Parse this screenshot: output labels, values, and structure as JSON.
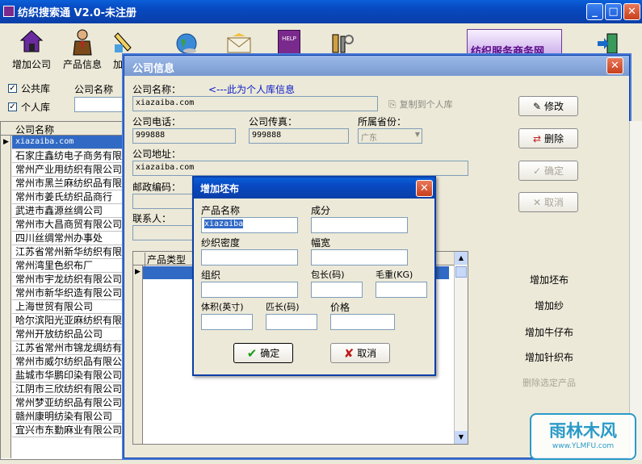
{
  "main": {
    "title": "纺织搜索通 V2.0-未注册",
    "toolbar": [
      {
        "label": "增加公司",
        "icon": "house-icon"
      },
      {
        "label": "产品信息",
        "icon": "businessman-icon"
      },
      {
        "label": "加",
        "icon": "pen-icon"
      },
      {
        "label": "",
        "icon": "globe-icon"
      },
      {
        "label": "",
        "icon": "mail-icon"
      },
      {
        "label": "",
        "icon": "help-book-icon"
      },
      {
        "label": "",
        "icon": "tools-icon"
      },
      {
        "label": "",
        "icon": "exit-icon"
      }
    ],
    "banner_text": "纺织服务商务网",
    "filter": {
      "public_label": "公共库",
      "private_label": "个人库",
      "company_name_label": "公司名称"
    },
    "grid": {
      "header": "公司名称",
      "rows": [
        "xiazaiba.com",
        "石家庄鑫纺电子商务有限公司",
        "常州产业用纺织有限公司",
        "常州市黑兰麻纺织品有限公司",
        "常州市姜氏纺织品商行",
        "武进市鑫源丝绸公司",
        "常州市大昌商贸有限公司",
        "四川丝绸常州办事处",
        "江苏省常州新华纺织有限公司",
        "常州湾里色织布厂",
        "常州市宇龙纺织有限公司",
        "常州市新华织造有限公司",
        "上海世贸有限公司",
        "哈尔滨阳光亚麻纺织有限公司",
        "常州开放纺织品公司",
        "江苏省常州市锦龙绸纺有限公司",
        "常州市威尔纺织品有限公司",
        "盐城市华鹏印染有限公司",
        "江阴市三欣纺织有限公司",
        "常州梦亚纺织品有限公司",
        "赣州康明纺染有限公司",
        "宜兴市东勤麻业有限公司"
      ]
    }
  },
  "company": {
    "title": "公司信息",
    "name_label": "公司名称：",
    "name_note": "<---此为个人库信息",
    "name_value": "xiazaiba.com",
    "copy_label": "复制到个人库",
    "phone_label": "公司电话：",
    "phone_value": "999888",
    "fax_label": "公司传真：",
    "fax_value": "999888",
    "province_label": "所属省份：",
    "province_value": "广东",
    "address_label": "公司地址：",
    "address_value": "xiazaiba.com",
    "zip_label": "邮政编码：",
    "contact_label": "联系人：",
    "btn_modify": "修改",
    "btn_delete": "删除",
    "btn_ok": "确定",
    "btn_cancel": "取消",
    "product_type_header": "产品类型",
    "action_links": [
      "增加坯布",
      "增加纱",
      "增加牛仔布",
      "增加针织布",
      "删除选定产品"
    ]
  },
  "dialog": {
    "title": "增加坯布",
    "product_name_label": "产品名称",
    "product_name_value": "xiazaiba",
    "composition_label": "成分",
    "density_label": "纱织密度",
    "width_label": "幅宽",
    "weave_label": "组织",
    "pack_label": "包长(码)",
    "weight_label": "毛重(KG)",
    "volume_label": "体积(英寸)",
    "piece_label": "匹长(码)",
    "price_label": "价格",
    "ok_label": "确定",
    "cancel_label": "取消"
  },
  "watermark": {
    "brand": "雨林木风",
    "url": "www.YLMFU.com"
  }
}
